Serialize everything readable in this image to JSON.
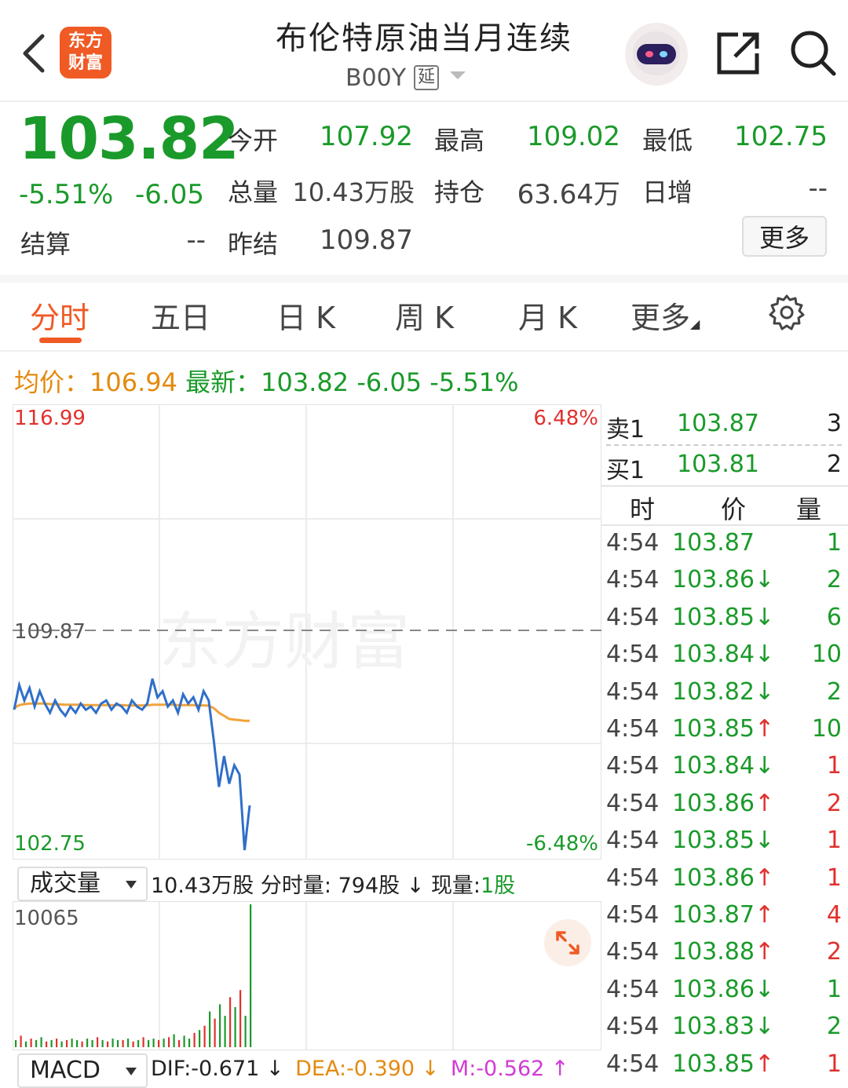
{
  "header": {
    "title": "布伦特原油当月连续",
    "code": "B00Y",
    "badge": "延",
    "logo_line1": "东方",
    "logo_line2": "财富"
  },
  "quote": {
    "price": "103.82",
    "change_pct": "-5.51%",
    "change": "-6.05",
    "open_label": "今开",
    "open": "107.92",
    "high_label": "最高",
    "high": "109.02",
    "low_label": "最低",
    "low": "102.75",
    "volume_label": "总量",
    "volume": "10.43万股",
    "position_label": "持仓",
    "position": "63.64万",
    "daily_inc_label": "日增",
    "daily_inc": "--",
    "settle_label": "结算",
    "settle": "--",
    "prev_settle_label": "昨结",
    "prev_settle": "109.87",
    "more": "更多"
  },
  "tabs": [
    "分时",
    "五日",
    "日 K",
    "周 K",
    "月 K",
    "更多"
  ],
  "info_line": {
    "avg_label": "均价：",
    "avg": "106.94",
    "latest_label": "最新：",
    "latest": "103.82",
    "change": "-6.05",
    "change_pct": "-5.51%"
  },
  "chart_labels": {
    "high": "116.99",
    "high_pct": "6.48%",
    "low": "102.75",
    "low_pct": "-6.48%",
    "ref": "109.87",
    "watermark": "东方财富"
  },
  "chart_data": {
    "type": "line",
    "ylim": [
      102.75,
      116.99
    ],
    "reference": 109.87,
    "series": [
      {
        "name": "",
        "color": "#2f6fc9",
        "values": [
          107.3,
          108.1,
          107.6,
          108.0,
          107.4,
          107.9,
          107.5,
          107.2,
          107.6,
          107.3,
          107.1,
          107.4,
          107.2,
          107.5,
          107.3,
          107.4,
          107.2,
          107.5,
          107.6,
          107.3,
          107.5,
          107.4,
          107.2,
          107.6,
          107.4,
          107.3,
          107.5,
          108.3,
          107.7,
          107.9,
          107.4,
          107.6,
          107.2,
          107.8,
          107.5,
          107.7,
          107.3,
          107.9,
          107.6,
          106.3,
          104.8,
          105.8,
          104.9,
          105.5,
          105.2,
          102.75,
          104.2
        ]
      },
      {
        "name": "",
        "color": "#f2a33a",
        "values": [
          107.35,
          107.45,
          107.48,
          107.5,
          107.5,
          107.5,
          107.5,
          107.48,
          107.48,
          107.47,
          107.46,
          107.46,
          107.46,
          107.46,
          107.45,
          107.45,
          107.45,
          107.45,
          107.45,
          107.45,
          107.45,
          107.45,
          107.44,
          107.44,
          107.44,
          107.44,
          107.44,
          107.46,
          107.46,
          107.46,
          107.46,
          107.46,
          107.45,
          107.45,
          107.45,
          107.45,
          107.44,
          107.44,
          107.43,
          107.35,
          107.2,
          107.1,
          107.0,
          106.98,
          106.96,
          106.94,
          106.94
        ]
      }
    ]
  },
  "volume": {
    "selector": "成交量",
    "total": "10.43万股",
    "minute_label": "分时量:",
    "minute_value": "794股",
    "now_label": "现量:",
    "now_value": "1股",
    "max_label": "10065",
    "bars": [
      0.05,
      0.08,
      0.04,
      0.06,
      0.05,
      0.07,
      0.04,
      0.05,
      0.06,
      0.04,
      0.05,
      0.06,
      0.05,
      0.04,
      0.06,
      0.05,
      0.07,
      0.05,
      0.04,
      0.06,
      0.05,
      0.05,
      0.06,
      0.04,
      0.05,
      0.07,
      0.05,
      0.06,
      0.05,
      0.06,
      0.07,
      0.09,
      0.05,
      0.08,
      0.06,
      0.1,
      0.12,
      0.15,
      0.25,
      0.2,
      0.3,
      0.22,
      0.35,
      0.28,
      0.4,
      0.22,
      1.0
    ],
    "bar_colors": [
      "g",
      "r",
      "g",
      "r",
      "g",
      "g",
      "r",
      "g",
      "r",
      "g",
      "r",
      "g",
      "g",
      "r",
      "g",
      "g",
      "r",
      "g",
      "r",
      "g",
      "g",
      "r",
      "g",
      "r",
      "g",
      "r",
      "g",
      "g",
      "r",
      "g",
      "r",
      "g",
      "r",
      "g",
      "g",
      "r",
      "g",
      "r",
      "g",
      "r",
      "g",
      "g",
      "r",
      "g",
      "r",
      "g",
      "g"
    ]
  },
  "macd": {
    "selector": "MACD",
    "dif": "DIF:-0.671",
    "dea": "DEA:-0.390",
    "m": "M:-0.562"
  },
  "order_book": {
    "sell_label": "卖1",
    "sell_price": "103.87",
    "sell_qty": "3",
    "buy_label": "买1",
    "buy_price": "103.81",
    "buy_qty": "2",
    "head_time": "时",
    "head_price": "价",
    "head_qty": "量"
  },
  "trades": [
    {
      "time": "4:54",
      "price": "103.87",
      "dir": "",
      "qty": "1",
      "qty_color": "green"
    },
    {
      "time": "4:54",
      "price": "103.86",
      "dir": "↓",
      "qty": "2",
      "qty_color": "green"
    },
    {
      "time": "4:54",
      "price": "103.85",
      "dir": "↓",
      "qty": "6",
      "qty_color": "green"
    },
    {
      "time": "4:54",
      "price": "103.84",
      "dir": "↓",
      "qty": "10",
      "qty_color": "green"
    },
    {
      "time": "4:54",
      "price": "103.82",
      "dir": "↓",
      "qty": "2",
      "qty_color": "green"
    },
    {
      "time": "4:54",
      "price": "103.85",
      "dir": "↑",
      "qty": "10",
      "qty_color": "green"
    },
    {
      "time": "4:54",
      "price": "103.84",
      "dir": "↓",
      "qty": "1",
      "qty_color": "red"
    },
    {
      "time": "4:54",
      "price": "103.86",
      "dir": "↑",
      "qty": "2",
      "qty_color": "red"
    },
    {
      "time": "4:54",
      "price": "103.85",
      "dir": "↓",
      "qty": "1",
      "qty_color": "red"
    },
    {
      "time": "4:54",
      "price": "103.86",
      "dir": "↑",
      "qty": "1",
      "qty_color": "red"
    },
    {
      "time": "4:54",
      "price": "103.87",
      "dir": "↑",
      "qty": "4",
      "qty_color": "red"
    },
    {
      "time": "4:54",
      "price": "103.88",
      "dir": "↑",
      "qty": "2",
      "qty_color": "red"
    },
    {
      "time": "4:54",
      "price": "103.86",
      "dir": "↓",
      "qty": "1",
      "qty_color": "green"
    },
    {
      "time": "4:54",
      "price": "103.83",
      "dir": "↓",
      "qty": "2",
      "qty_color": "green"
    },
    {
      "time": "4:54",
      "price": "103.85",
      "dir": "↑",
      "qty": "1",
      "qty_color": "red"
    }
  ]
}
